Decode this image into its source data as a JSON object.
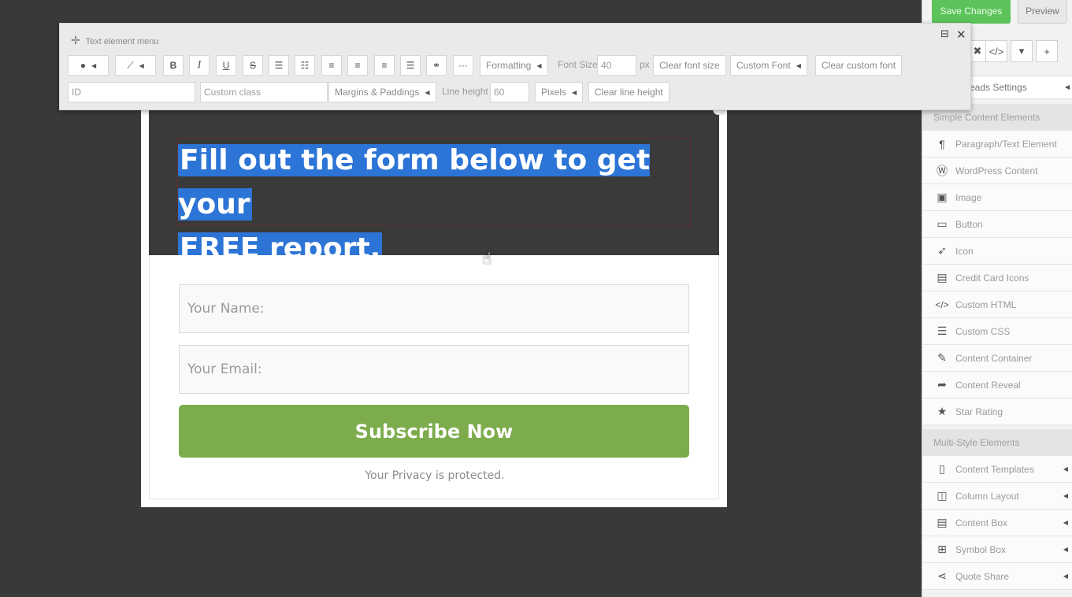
{
  "top_buttons": {
    "save": "Save Changes",
    "preview": "Preview"
  },
  "text_menu": {
    "title": "Text element menu",
    "font_size_label": "Font Size",
    "font_size_value": "40",
    "font_size_unit": "px",
    "formatting": "Formatting",
    "clear_font_size": "Clear font size",
    "custom_font": "Custom Font",
    "clear_custom_font": "Clear custom font",
    "id_placeholder": "ID",
    "class_placeholder": "Custom class",
    "margins": "Margins & Paddings",
    "line_height_label": "Line height",
    "line_height_value": "60",
    "pixels": "Pixels",
    "clear_line_height": "Clear line height",
    "more": "···"
  },
  "form": {
    "headline_line1": "Fill out the form below to get your",
    "headline_line2": "FREE report.",
    "name_placeholder": "Your Name:",
    "email_placeholder": "Your Email:",
    "button": "Subscribe Now",
    "privacy": "Your Privacy is protected."
  },
  "sidebar": {
    "settings": "eads Settings",
    "section_simple": "Simple Content Elements",
    "simple_items": [
      {
        "label": "Paragraph/Text Element",
        "icon": "paragraph-icon"
      },
      {
        "label": "WordPress Content",
        "icon": "wordpress-icon"
      },
      {
        "label": "Image",
        "icon": "image-icon"
      },
      {
        "label": "Button",
        "icon": "button-icon"
      },
      {
        "label": "Icon",
        "icon": "rocket-icon"
      },
      {
        "label": "Credit Card Icons",
        "icon": "credit-card-icon"
      },
      {
        "label": "Custom HTML",
        "icon": "code-icon"
      },
      {
        "label": "Custom CSS",
        "icon": "css-icon"
      },
      {
        "label": "Content Container",
        "icon": "edit-icon"
      },
      {
        "label": "Content Reveal",
        "icon": "share-arrow-icon"
      },
      {
        "label": "Star Rating",
        "icon": "star-icon"
      }
    ],
    "section_multi": "Multi-Style Elements",
    "multi_items": [
      {
        "label": "Content Templates",
        "icon": "document-icon"
      },
      {
        "label": "Column Layout",
        "icon": "columns-icon"
      },
      {
        "label": "Content Box",
        "icon": "content-box-icon"
      },
      {
        "label": "Symbol Box",
        "icon": "symbol-box-icon"
      },
      {
        "label": "Quote Share",
        "icon": "share-icon"
      }
    ]
  }
}
